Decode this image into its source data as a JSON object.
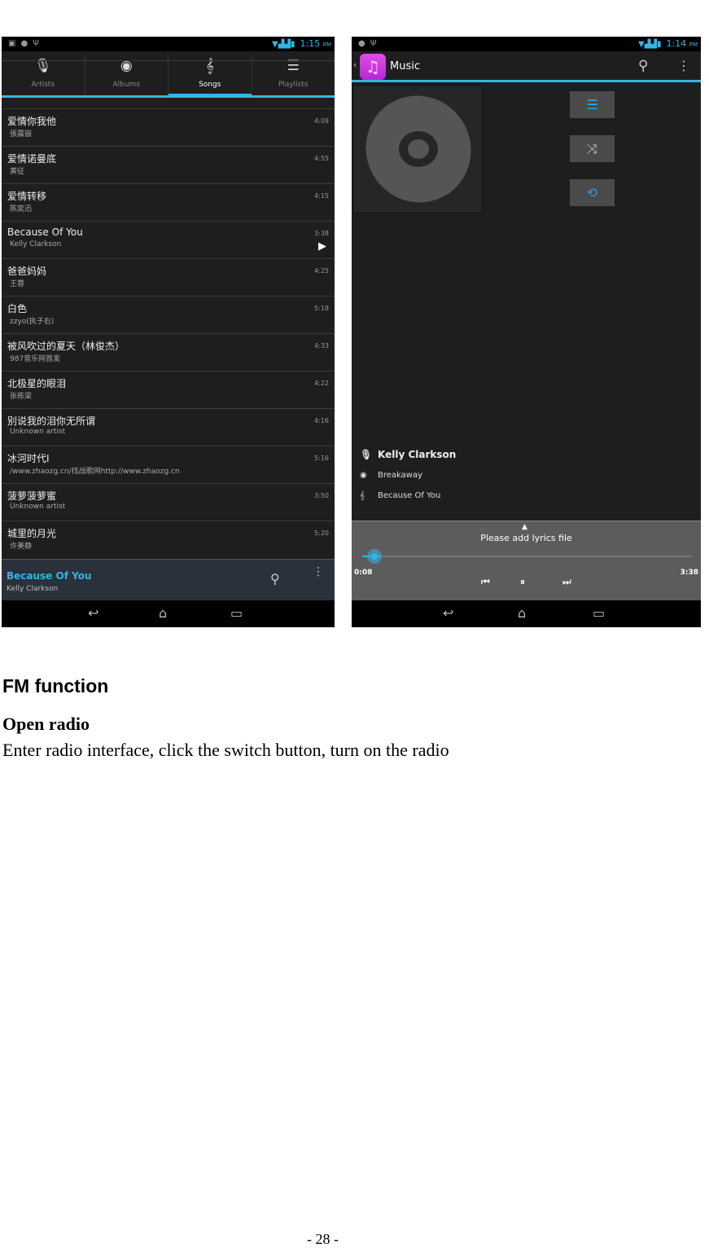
{
  "left_screen": {
    "status": {
      "time": "1:15",
      "ampm": "PM"
    },
    "tabs": [
      {
        "label": "Artists",
        "icon": "microphone-icon"
      },
      {
        "label": "Albums",
        "icon": "disc-icon"
      },
      {
        "label": "Songs",
        "icon": "treble-clef-icon",
        "active": true
      },
      {
        "label": "Playlists",
        "icon": "playlist-icon"
      }
    ],
    "songs": [
      {
        "title": "爱情你我他",
        "artist": "張震嶽",
        "duration": "4:09"
      },
      {
        "title": "爱情诺曼底",
        "artist": "黄征",
        "duration": "4:55"
      },
      {
        "title": "爱情转移",
        "artist": "陈奕迅",
        "duration": "4:15"
      },
      {
        "title": "Because Of You",
        "artist": "Kelly Clarkson",
        "duration": "3:38",
        "playing": true
      },
      {
        "title": "爸爸妈妈",
        "artist": "王蓉",
        "duration": "4:25"
      },
      {
        "title": "白色",
        "artist": "zzyo(执子右)",
        "duration": "5:18"
      },
      {
        "title": "被风吹过的夏天（林俊杰）",
        "artist": "987音乐网首发",
        "duration": "4:33"
      },
      {
        "title": "北极星的眼泪",
        "artist": "张栋梁",
        "duration": "4:22"
      },
      {
        "title": "别说我的泪你无所谓",
        "artist": "Unknown artist",
        "duration": "4:16"
      },
      {
        "title": "冰河时代Ⅰ",
        "artist": "/www.zhaozg.cn/找战歌网http://www.zhaozg.cn",
        "duration": "5:16"
      },
      {
        "title": "菠萝菠萝蜜",
        "artist": "Unknown artist",
        "duration": "3:50"
      },
      {
        "title": "城里的月光",
        "artist": "许美静",
        "duration": "5:20"
      }
    ],
    "now_playing": {
      "title": "Because Of You",
      "artist": "Kelly Clarkson"
    }
  },
  "right_screen": {
    "status": {
      "time": "1:14",
      "ampm": "PM"
    },
    "app_title": "Music",
    "artist": "Kelly Clarkson",
    "album": "Breakaway",
    "track": "Because Of You",
    "lyrics_hint": "Please add lyrics file",
    "elapsed": "0:08",
    "total": "3:38",
    "progress_fraction": 0.037
  },
  "colors": {
    "accent": "#33b5e5"
  },
  "document": {
    "heading": "FM function",
    "subheading": "Open radio",
    "body": "Enter radio interface, click the switch button, turn on the radio",
    "page_number": "- 28 -"
  }
}
